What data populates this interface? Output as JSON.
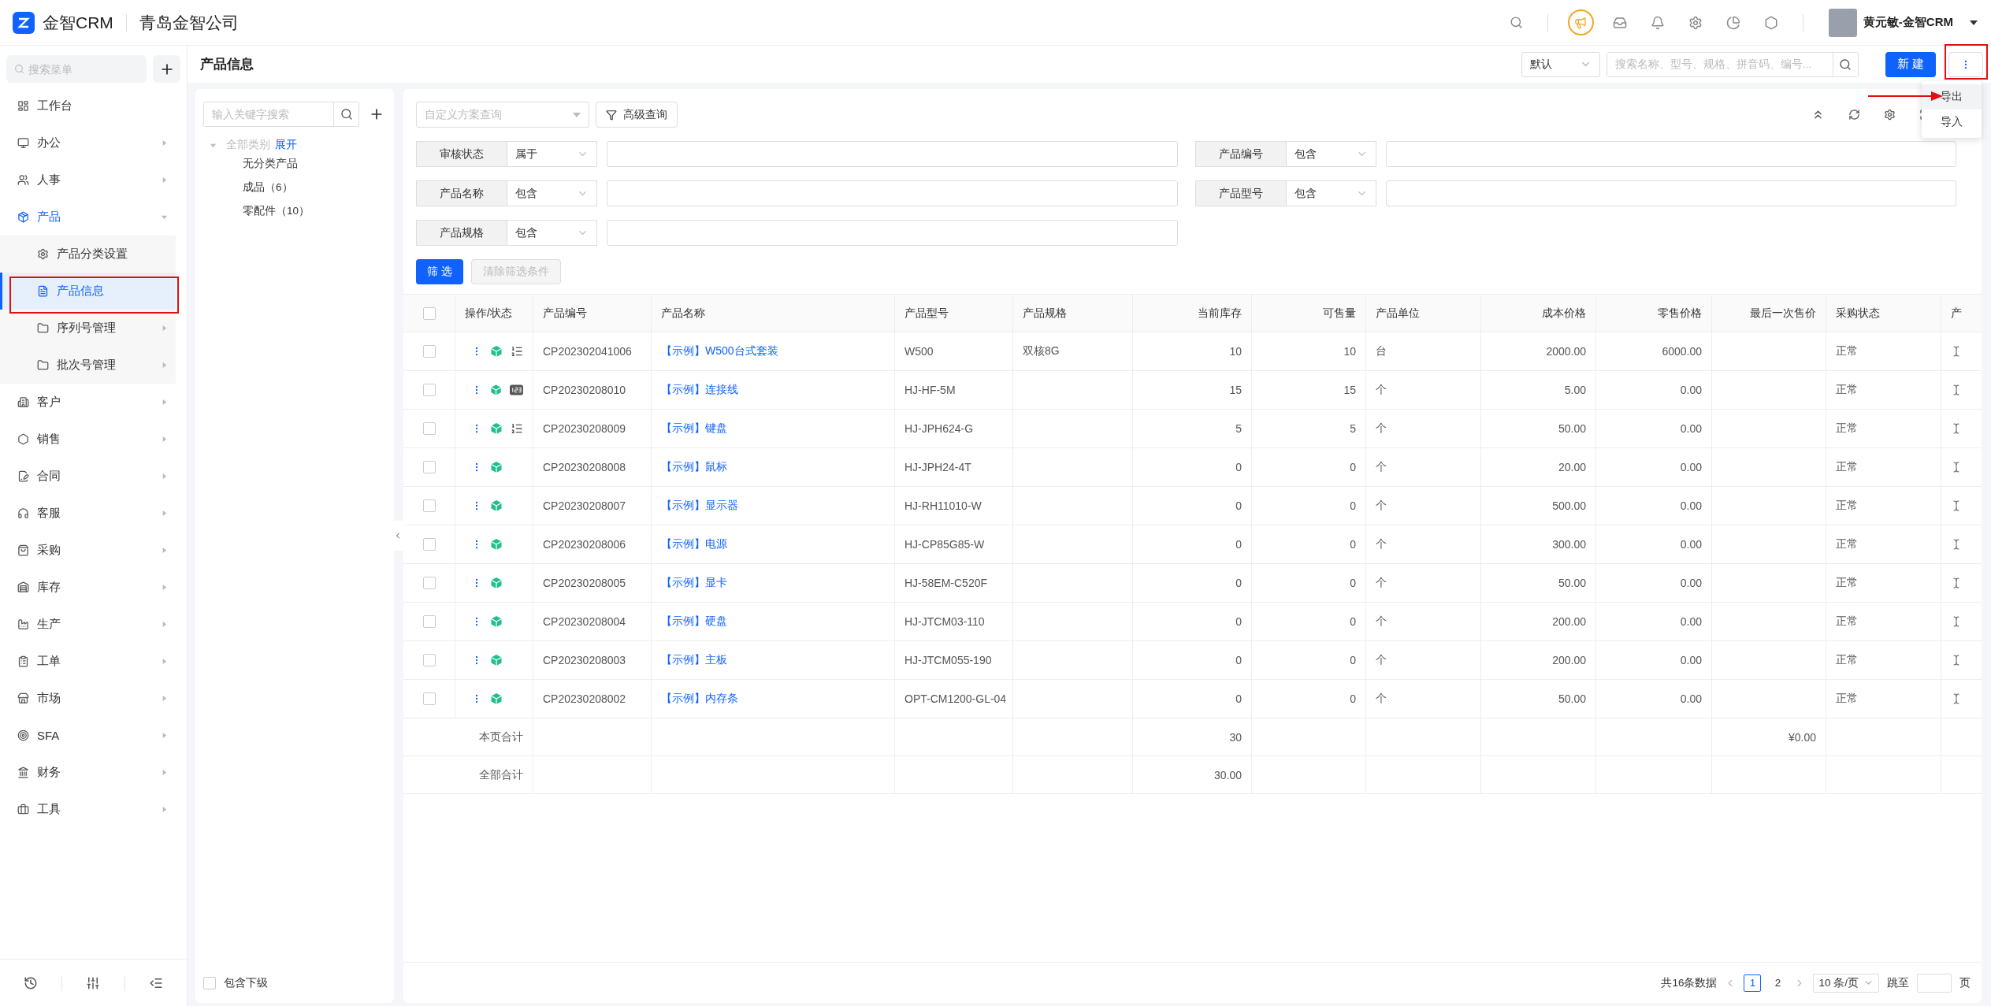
{
  "header": {
    "logo_text": "金智CRM",
    "company": "青岛金智公司",
    "user_name": "黄元敏-金智CRM"
  },
  "sidebar": {
    "search_placeholder": "搜索菜单",
    "items": [
      {
        "label": "工作台",
        "kind": "link",
        "selected": false
      },
      {
        "label": "办公",
        "kind": "group",
        "expanded": false,
        "selected": false
      },
      {
        "label": "人事",
        "kind": "group",
        "expanded": false,
        "selected": false
      },
      {
        "label": "产品",
        "kind": "group",
        "expanded": true,
        "selected": false,
        "children": [
          {
            "label": "产品分类设置",
            "kind": "link",
            "selected": false
          },
          {
            "label": "产品信息",
            "kind": "link",
            "selected": true
          },
          {
            "label": "序列号管理",
            "kind": "group",
            "expanded": false,
            "selected": false
          },
          {
            "label": "批次号管理",
            "kind": "group",
            "expanded": false,
            "selected": false
          }
        ]
      },
      {
        "label": "客户",
        "kind": "group",
        "expanded": false,
        "selected": false
      },
      {
        "label": "销售",
        "kind": "group",
        "expanded": false,
        "selected": false
      },
      {
        "label": "合同",
        "kind": "group",
        "expanded": false,
        "selected": false
      },
      {
        "label": "客服",
        "kind": "group",
        "expanded": false,
        "selected": false
      },
      {
        "label": "采购",
        "kind": "group",
        "expanded": false,
        "selected": false
      },
      {
        "label": "库存",
        "kind": "group",
        "expanded": false,
        "selected": false
      },
      {
        "label": "生产",
        "kind": "group",
        "expanded": false,
        "selected": false
      },
      {
        "label": "工单",
        "kind": "group",
        "expanded": false,
        "selected": false
      },
      {
        "label": "市场",
        "kind": "group",
        "expanded": false,
        "selected": false
      },
      {
        "label": "SFA",
        "kind": "group",
        "expanded": false,
        "selected": false
      },
      {
        "label": "财务",
        "kind": "group",
        "expanded": false,
        "selected": false
      },
      {
        "label": "工具",
        "kind": "group",
        "expanded": false,
        "selected": false
      }
    ]
  },
  "page": {
    "title": "产品信息",
    "view_select": "默认",
    "search_placeholder": "搜索名称、型号、规格、拼音码、编号...",
    "new_button": "新 建",
    "more_menu": [
      {
        "label": "导出",
        "selected": true
      },
      {
        "label": "导入",
        "selected": false
      }
    ]
  },
  "tree": {
    "search_placeholder": "输入关键字搜索",
    "root": {
      "label": "全部类别",
      "action": "展开",
      "expanded": true,
      "children": [
        {
          "label": "无分类产品"
        },
        {
          "label": "成品（6）"
        },
        {
          "label": "零配件（10）"
        }
      ]
    },
    "include_sub": {
      "label": "包含下级",
      "checked": false
    }
  },
  "filters": {
    "scheme_placeholder": "自定义方案查询",
    "advanced_button": "高级查询",
    "conditions": [
      {
        "field": "审核状态",
        "operator": "属于"
      },
      {
        "field": "产品编号",
        "operator": "包含"
      },
      {
        "field": "产品名称",
        "operator": "包含"
      },
      {
        "field": "产品型号",
        "operator": "包含"
      },
      {
        "field": "产品规格",
        "operator": "包含"
      }
    ],
    "apply_button": {
      "label": "筛 选",
      "disabled": false
    },
    "clear_button": {
      "label": "清除筛选条件",
      "disabled": true
    }
  },
  "table": {
    "select_all": {
      "checked": false
    },
    "columns": [
      {
        "label": "操作/状态",
        "numeric": false
      },
      {
        "label": "产品编号",
        "numeric": false
      },
      {
        "label": "产品名称",
        "numeric": false
      },
      {
        "label": "产品型号",
        "numeric": false
      },
      {
        "label": "产品规格",
        "numeric": false
      },
      {
        "label": "当前库存",
        "numeric": true
      },
      {
        "label": "可售量",
        "numeric": true
      },
      {
        "label": "产品单位",
        "numeric": false
      },
      {
        "label": "成本价格",
        "numeric": true
      },
      {
        "label": "零售价格",
        "numeric": true
      },
      {
        "label": "最后一次售价",
        "numeric": true
      },
      {
        "label": "采购状态",
        "numeric": false
      },
      {
        "label": "产",
        "numeric": false
      }
    ],
    "rows": [
      {
        "checked": false,
        "kind": "list",
        "code": "CP202302041006",
        "name": "【示例】W500台式套装",
        "model": "W500",
        "spec": "双核8G",
        "stock": "10",
        "available": "10",
        "unit": "台",
        "cost": "2000.00",
        "retail": "6000.00",
        "status": "正常"
      },
      {
        "checked": false,
        "kind": "number",
        "code": "CP20230208010",
        "name": "【示例】连接线",
        "model": "HJ-HF-5M",
        "stock": "15",
        "available": "15",
        "unit": "个",
        "cost": "5.00",
        "retail": "0.00",
        "status": "正常"
      },
      {
        "checked": false,
        "kind": "list",
        "code": "CP20230208009",
        "name": "【示例】键盘",
        "model": "HJ-JPH624-G",
        "stock": "5",
        "available": "5",
        "unit": "个",
        "cost": "50.00",
        "retail": "0.00",
        "status": "正常"
      },
      {
        "checked": false,
        "kind": "plain",
        "code": "CP20230208008",
        "name": "【示例】鼠标",
        "model": "HJ-JPH24-4T",
        "stock": "0",
        "available": "0",
        "unit": "个",
        "cost": "20.00",
        "retail": "0.00",
        "status": "正常"
      },
      {
        "checked": false,
        "kind": "plain",
        "code": "CP20230208007",
        "name": "【示例】显示器",
        "model": "HJ-RH11010-W",
        "stock": "0",
        "available": "0",
        "unit": "个",
        "cost": "500.00",
        "retail": "0.00",
        "status": "正常"
      },
      {
        "checked": false,
        "kind": "plain",
        "code": "CP20230208006",
        "name": "【示例】电源",
        "model": "HJ-CP85G85-W",
        "stock": "0",
        "available": "0",
        "unit": "个",
        "cost": "300.00",
        "retail": "0.00",
        "status": "正常"
      },
      {
        "checked": false,
        "kind": "plain",
        "code": "CP20230208005",
        "name": "【示例】显卡",
        "model": "HJ-58EM-C520F",
        "stock": "0",
        "available": "0",
        "unit": "个",
        "cost": "50.00",
        "retail": "0.00",
        "status": "正常"
      },
      {
        "checked": false,
        "kind": "plain",
        "code": "CP20230208004",
        "name": "【示例】硬盘",
        "model": "HJ-JTCM03-110",
        "stock": "0",
        "available": "0",
        "unit": "个",
        "cost": "200.00",
        "retail": "0.00",
        "status": "正常"
      },
      {
        "checked": false,
        "kind": "plain",
        "code": "CP20230208003",
        "name": "【示例】主板",
        "model": "HJ-JTCM055-190",
        "stock": "0",
        "available": "0",
        "unit": "个",
        "cost": "200.00",
        "retail": "0.00",
        "status": "正常"
      },
      {
        "checked": false,
        "kind": "plain",
        "code": "CP20230208002",
        "name": "【示例】内存条",
        "model": "OPT-CM1200-GL-04",
        "stock": "0",
        "available": "0",
        "unit": "个",
        "cost": "50.00",
        "retail": "0.00",
        "status": "正常"
      }
    ],
    "totals": [
      {
        "label": "本页合计",
        "stock": "30",
        "last_price": "¥0.00"
      },
      {
        "label": "全部合计",
        "stock": "30.00"
      }
    ]
  },
  "pagination": {
    "total": "共16条数据",
    "pages": [
      {
        "label": "1",
        "selected": true
      },
      {
        "label": "2",
        "selected": false
      }
    ],
    "page_size": "10 条/页",
    "jump_label": "跳至",
    "page_suffix": "页"
  }
}
